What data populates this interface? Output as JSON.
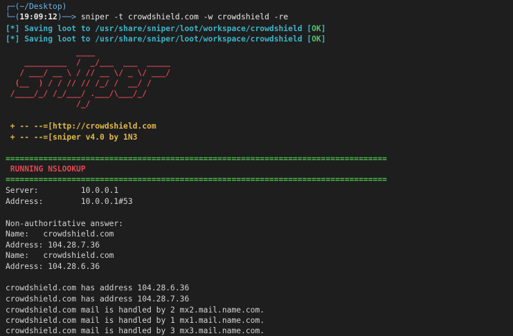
{
  "prompt": {
    "dir": "~/Desktop",
    "time": "19:09:12",
    "arrow": "──>",
    "command": "sniper -t crowdshield.com -w crowdshield -re"
  },
  "loot_lines": [
    {
      "prefix": "[*]",
      "text": "Saving loot to /usr/share/sniper/loot/workspace/crowdshield",
      "status": "OK"
    },
    {
      "prefix": "[*]",
      "text": "Saving loot to /usr/share/sniper/loot/workspace/crowdshield",
      "status": "OK"
    }
  ],
  "ascii_art": [
    "               ____",
    "    _________  /  _/___  ___  _____",
    "   / ___/ __ \\ / // __ \\/ _ \\/ ___/",
    "  (__  ) / / // // /_/ /  __/ /",
    " /____/_/ /_/___/ .___/\\___/_/",
    "               /_/"
  ],
  "banner": {
    "url_line": " + -- --=[http://crowdshield.com",
    "version_line": " + -- --=[sniper v4.0 by 1N3"
  },
  "separator": "=================================================================================",
  "section_title": " RUNNING NSLOOKUP",
  "output_lines": [
    "Server:         10.0.0.1",
    "Address:        10.0.0.1#53",
    "",
    "Non-authoritative answer:",
    "Name:   crowdshield.com",
    "Address: 104.28.7.36",
    "Name:   crowdshield.com",
    "Address: 104.28.6.36",
    "",
    "crowdshield.com has address 104.28.6.36",
    "crowdshield.com has address 104.28.7.36",
    "crowdshield.com mail is handled by 2 mx2.mail.name.com.",
    "crowdshield.com mail is handled by 1 mx1.mail.name.com.",
    "crowdshield.com mail is handled by 3 mx3.mail.name.com."
  ],
  "colors": {
    "background": "#1e1e1e",
    "accent_cyan": "#3cb4c8",
    "ok_green": "#56c26a",
    "art_red": "#e04852",
    "banner_yellow": "#e0b84a"
  }
}
